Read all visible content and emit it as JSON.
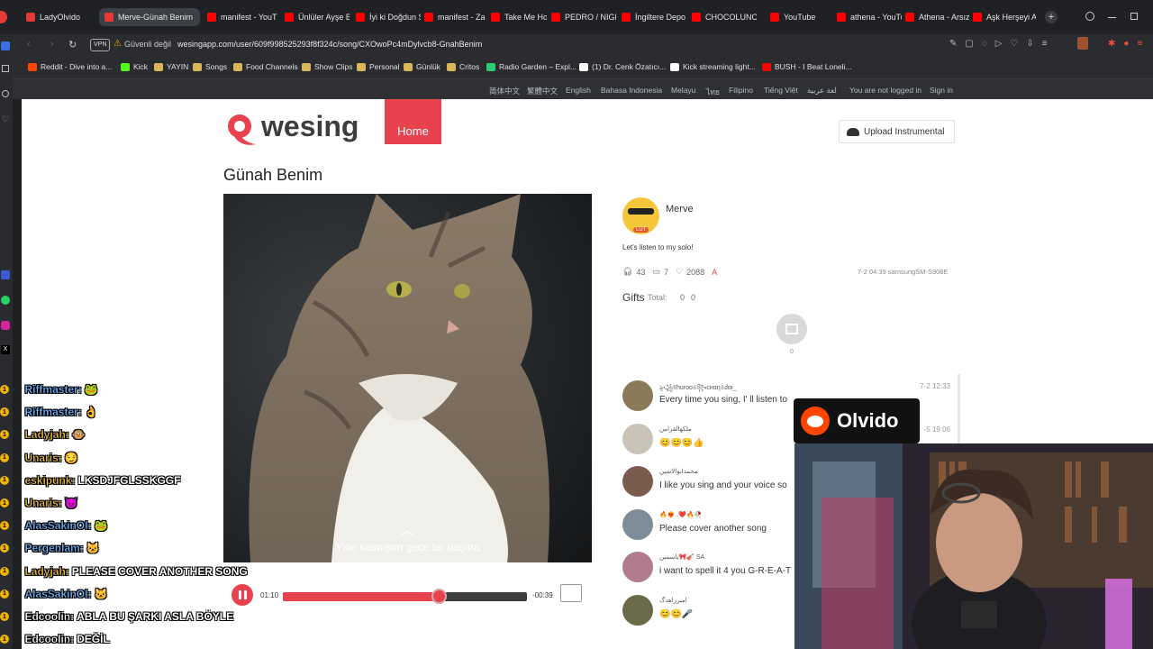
{
  "tabs": [
    {
      "label": "LadyOlvido",
      "color": "#e53935"
    },
    {
      "label": "Merve-Günah Benim",
      "color": "#e53935"
    },
    {
      "label": "manifest - YouT",
      "color": "#ff0000"
    },
    {
      "label": "Ünlüler Ayşe B",
      "color": "#ff0000"
    },
    {
      "label": "İyi ki Doğdun S",
      "color": "#ff0000"
    },
    {
      "label": "manifest - Zam",
      "color": "#ff0000"
    },
    {
      "label": "Take Me Home",
      "color": "#ff0000"
    },
    {
      "label": "PEDRO / NIGH",
      "color": "#ff0000"
    },
    {
      "label": "İngiltere Depo",
      "color": "#ff0000"
    },
    {
      "label": "CHOCOLUNCH",
      "color": "#ff0000"
    },
    {
      "label": "YouTube",
      "color": "#ff0000"
    },
    {
      "label": "athena - YouTu",
      "color": "#ff0000"
    },
    {
      "label": "Athena - Arsız",
      "color": "#ff0000"
    },
    {
      "label": "Aşk Herşeyi Af",
      "color": "#ff0000"
    }
  ],
  "address": {
    "vpn": "VPN",
    "security": "Güvenli değil",
    "url": "wesingapp.com/user/609f998525293f8f324c/song/CXOwoPc4mDylvcb8-GnahBenim"
  },
  "bookmarks": [
    {
      "label": "Reddit - Dive into a...",
      "color": "#ff4500"
    },
    {
      "label": "Kick",
      "color": "#53fc18"
    },
    {
      "label": "YAYIN",
      "color": "#d9b75a"
    },
    {
      "label": "Songs",
      "color": "#d9b75a"
    },
    {
      "label": "Food Channels",
      "color": "#d9b75a"
    },
    {
      "label": "Show Clips",
      "color": "#d9b75a"
    },
    {
      "label": "Personal",
      "color": "#d9b75a"
    },
    {
      "label": "Günlük",
      "color": "#d9b75a"
    },
    {
      "label": "Critos",
      "color": "#d9b75a"
    },
    {
      "label": "Radio Garden – Expl...",
      "color": "#2ecc71"
    },
    {
      "label": "(1) Dr. Cenk Özatıcı...",
      "color": "#ffffff"
    },
    {
      "label": "Kick streaming light...",
      "color": "#ffffff"
    },
    {
      "label": "BUSH - I Beat Loneli...",
      "color": "#ff0000"
    }
  ],
  "languages": [
    "简体中文",
    "繁體中文",
    "English",
    "Bahasa Indonesia",
    "Melayu",
    "ไทย",
    "Filipino",
    "Tiếng Việt",
    "لغة عربية"
  ],
  "login": {
    "status": "You are not logged in",
    "signin": "Sign in"
  },
  "site": {
    "brand": "wesing",
    "home": "Home",
    "upload": "Upload Instrumental"
  },
  "song": {
    "title": "Günah Benim",
    "lyric": "Yine kalmışım gece bir başına"
  },
  "player": {
    "elapsed": "01:10",
    "remaining": "-00:39",
    "progress": 0.64
  },
  "user": {
    "name": "Merve",
    "avatar_badge": "LUT",
    "desc": "Let's listen to my solo!",
    "listens": "43",
    "comments": "7",
    "gifts": "2088",
    "tag": "A",
    "meta": "7-2 04:39 samsungSM-S908E"
  },
  "gifts": {
    "label": "Gifts",
    "total_label": "Total:",
    "total_a": "0",
    "total_b": "0",
    "count": "0"
  },
  "comments": [
    {
      "user": "ৡ꧁ষhuroo৪꧂ᴄнαη৪ძαι_",
      "text": "Every time you sing, I' ll listen to",
      "time": "7-2 12:33",
      "color": "#8a7a5a"
    },
    {
      "user": "ملكهالقرامن",
      "text": "😊😊😊👍",
      "time": "-5 19:06",
      "color": "#c9c3b8"
    },
    {
      "user": "محمدابوالاشين",
      "text": "I like you sing and your voice so",
      "time": "",
      "color": "#7c5b4f"
    },
    {
      "user": "🔥❤️‍🔥..❤️🔥🥀",
      "text": "Please cover another song",
      "time": "",
      "color": "#7f8c99"
    },
    {
      "user": "یاسمین🎀🎻 SA",
      "text": "i want to spell it 4 you G-R-E-A-T",
      "time": "",
      "color": "#b07a8f"
    },
    {
      "user": "امیرزاهدگ",
      "text": "😊😊🎤",
      "time": "",
      "color": "#6b6a4a"
    }
  ],
  "overlay": {
    "name": "Olvido"
  },
  "chat": [
    {
      "nick": "Riffmaster:",
      "msg": "🐸",
      "color": "#6fb7ff"
    },
    {
      "nick": "Riffmaster:",
      "msg": "👌",
      "color": "#6fb7ff"
    },
    {
      "nick": "Ladyjah:",
      "msg": "🐵",
      "color": "#f0c040"
    },
    {
      "nick": "Unaris:",
      "msg": "😏",
      "color": "#f0c040"
    },
    {
      "nick": "eskipunk:",
      "msg": "LKSDJFGLSSKGGF",
      "color": "#f0c040"
    },
    {
      "nick": "Unaris:",
      "msg": "😈",
      "color": "#f0c040"
    },
    {
      "nick": "AlasSakinOl:",
      "msg": "🐸",
      "color": "#6fb7ff"
    },
    {
      "nick": "Pergenlam:",
      "msg": "🐱",
      "color": "#6fb7ff"
    },
    {
      "nick": "Ladyjah:",
      "msg": "PLEASE COVER ANOTHER SONG",
      "color": "#f0c040"
    },
    {
      "nick": "AlasSakinOl:",
      "msg": "🐱",
      "color": "#6fb7ff"
    },
    {
      "nick": "Edcoolin:",
      "msg": "ABLA BU ŞARKI ASLA BÖYLE",
      "color": "#ffffff"
    },
    {
      "nick": "Edcoolin:",
      "msg": "DEĞİL",
      "color": "#ffffff"
    }
  ]
}
